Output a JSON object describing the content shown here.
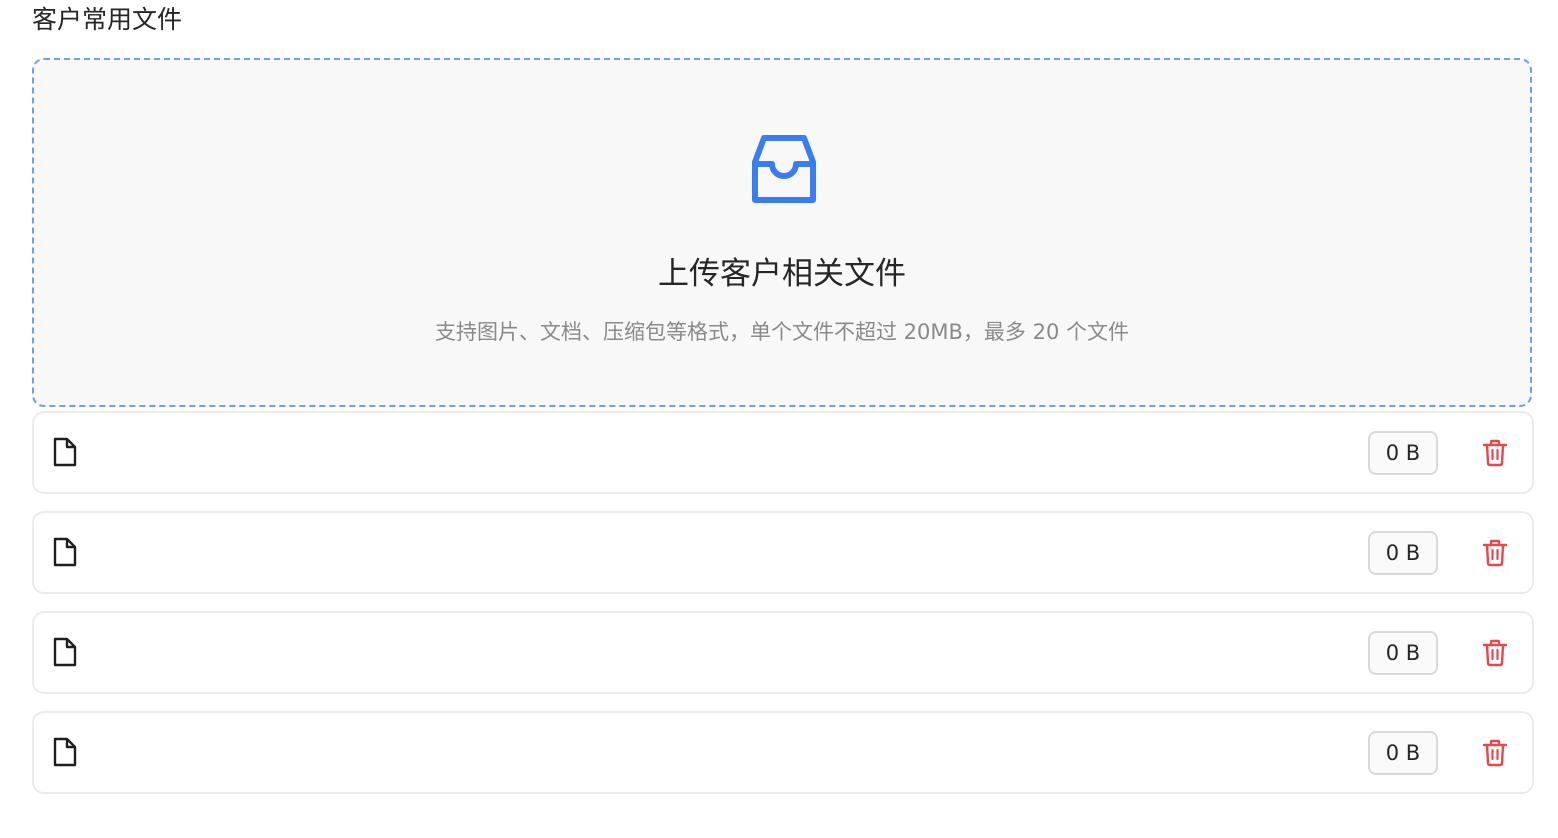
{
  "section": {
    "title": "客户常用文件"
  },
  "upload": {
    "icon": "inbox-icon",
    "accent_color": "#3b7cf0",
    "title": "上传客户相关文件",
    "hint": "支持图片、文档、压缩包等格式，单个文件不超过 20MB，最多 20 个文件"
  },
  "files": [
    {
      "icon": "file-icon",
      "name": "",
      "size": "0 B",
      "delete_icon": "trash-icon"
    },
    {
      "icon": "file-icon",
      "name": "",
      "size": "0 B",
      "delete_icon": "trash-icon"
    },
    {
      "icon": "file-icon",
      "name": "",
      "size": "0 B",
      "delete_icon": "trash-icon"
    },
    {
      "icon": "file-icon",
      "name": "",
      "size": "0 B",
      "delete_icon": "trash-icon"
    }
  ],
  "colors": {
    "delete": "#e5484d",
    "dropzone_border": "#6f9ef2"
  }
}
